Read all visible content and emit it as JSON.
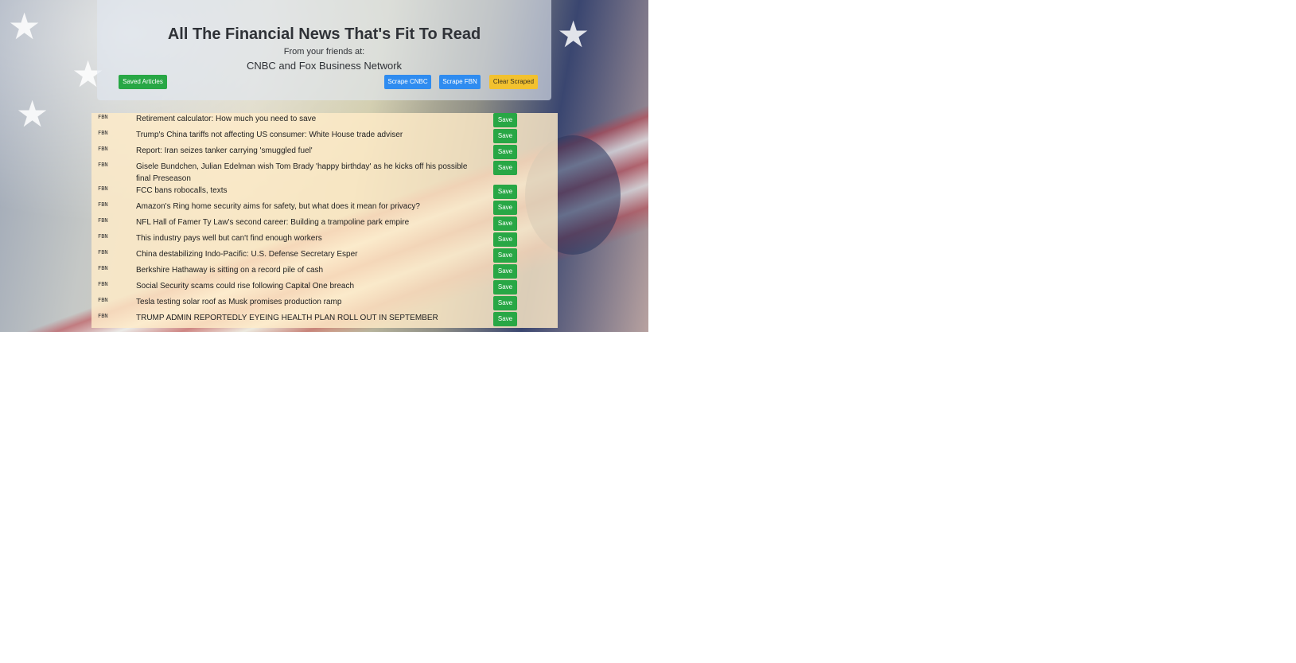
{
  "header": {
    "title": "All The Financial News That's Fit To Read",
    "subtitle": "From your friends at:",
    "networks": "CNBC and Fox Business Network",
    "saved_articles_label": "Saved Articles",
    "scrape_cnbc_label": "Scrape CNBC",
    "scrape_fbn_label": "Scrape FBN",
    "clear_scraped_label": "Clear Scraped"
  },
  "articles": [
    {
      "source": "FBN",
      "headline": "Retirement calculator: How much you need to save",
      "save_label": "Save"
    },
    {
      "source": "FBN",
      "headline": "Trump's China tariffs not affecting US consumer: White House trade adviser",
      "save_label": "Save"
    },
    {
      "source": "FBN",
      "headline": "Report: Iran seizes tanker carrying 'smuggled fuel'",
      "save_label": "Save"
    },
    {
      "source": "FBN",
      "headline": "Gisele Bundchen, Julian Edelman wish Tom Brady 'happy birthday' as he kicks off his possible final Preseason",
      "save_label": "Save"
    },
    {
      "source": "FBN",
      "headline": "FCC bans robocalls, texts",
      "save_label": "Save"
    },
    {
      "source": "FBN",
      "headline": "Amazon's Ring home security aims for safety, but what does it mean for privacy?",
      "save_label": "Save"
    },
    {
      "source": "FBN",
      "headline": "NFL Hall of Famer Ty Law's second career: Building a trampoline park empire",
      "save_label": "Save"
    },
    {
      "source": "FBN",
      "headline": "This industry pays well but can't find enough workers",
      "save_label": "Save"
    },
    {
      "source": "FBN",
      "headline": "China destabilizing Indo-Pacific: U.S. Defense Secretary Esper",
      "save_label": "Save"
    },
    {
      "source": "FBN",
      "headline": "Berkshire Hathaway is sitting on a record pile of cash",
      "save_label": "Save"
    },
    {
      "source": "FBN",
      "headline": "Social Security scams could rise following Capital One breach",
      "save_label": "Save"
    },
    {
      "source": "FBN",
      "headline": "Tesla testing solar roof as Musk promises production ramp",
      "save_label": "Save"
    },
    {
      "source": "FBN",
      "headline": "TRUMP ADMIN REPORTEDLY EYEING HEALTH PLAN ROLL OUT IN SEPTEMBER",
      "save_label": "Save"
    }
  ]
}
